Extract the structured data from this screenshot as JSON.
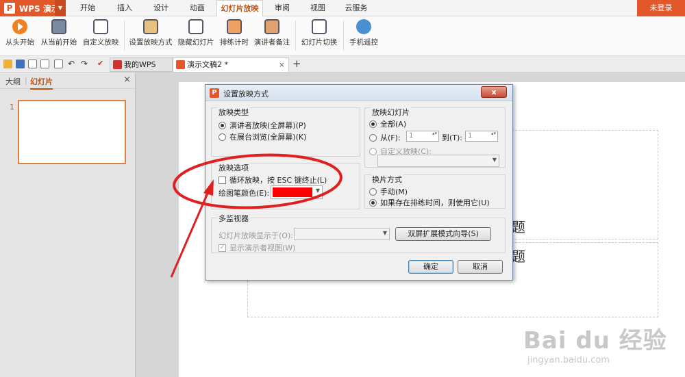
{
  "app": {
    "name": "WPS 演示",
    "logo_letter": "P",
    "login_label": "未登录"
  },
  "menu_tabs": [
    "开始",
    "插入",
    "设计",
    "动画",
    "幻灯片放映",
    "审阅",
    "视图",
    "云服务"
  ],
  "ribbon": [
    {
      "label": "从头开始",
      "icon": "play-icon"
    },
    {
      "label": "从当前开始",
      "icon": "play-current-icon"
    },
    {
      "label": "自定义放映",
      "icon": "custom-show-icon"
    },
    {
      "label": "设置放映方式",
      "icon": "setup-show-icon"
    },
    {
      "label": "隐藏幻灯片",
      "icon": "hide-slide-icon"
    },
    {
      "label": "排练计时",
      "icon": "rehearse-timing-icon"
    },
    {
      "label": "演讲者备注",
      "icon": "presenter-notes-icon"
    },
    {
      "label": "幻灯片切换",
      "icon": "slide-transition-icon"
    },
    {
      "label": "手机遥控",
      "icon": "phone-remote-icon"
    }
  ],
  "doc_tabs": [
    {
      "label": "我的WPS",
      "icon": "wps-logo-icon"
    },
    {
      "label": "演示文稿2 *",
      "icon": "ppt-doc-icon",
      "close": "×"
    }
  ],
  "new_tab_label": "+",
  "left_pane": {
    "tabs": [
      "大纲",
      "幻灯片"
    ],
    "close": "×",
    "slide_number": "1"
  },
  "slide": {
    "line1": "题",
    "line2": "题"
  },
  "dialog": {
    "title": "设置放映方式",
    "close": "x",
    "show_type": {
      "title": "放映类型",
      "options": [
        "演讲者放映(全屏幕)(P)",
        "在展台浏览(全屏幕)(K)"
      ],
      "selected": 0
    },
    "slides": {
      "title": "放映幻灯片",
      "all": "全部(A)",
      "from": "从(F):",
      "from_value": "1",
      "to": "到(T):",
      "to_value": "1",
      "custom": "自定义放映(C):"
    },
    "show_options": {
      "title": "放映选项",
      "loop": "循环放映，按 ESC 键终止(L)",
      "loop_checked": false,
      "pen_color_label": "绘图笔颜色(E):",
      "pen_color": "#ff0000"
    },
    "advance": {
      "title": "换片方式",
      "options": [
        "手动(M)",
        "如果存在排练时间，则使用它(U)"
      ],
      "selected": 1
    },
    "monitors": {
      "title": "多监视器",
      "display_on": "幻灯片放映显示于(O):",
      "wizard_button": "双屏扩展模式向导(S)",
      "presenter_view": "显示演示者视图(W)",
      "presenter_view_checked": true
    },
    "ok": "确定",
    "cancel": "取消"
  },
  "colors": {
    "accent": "#e2582a",
    "annotation": "#e02020"
  },
  "watermark": {
    "main": "Bai du 经验",
    "sub": "jingyan.baidu.com"
  }
}
